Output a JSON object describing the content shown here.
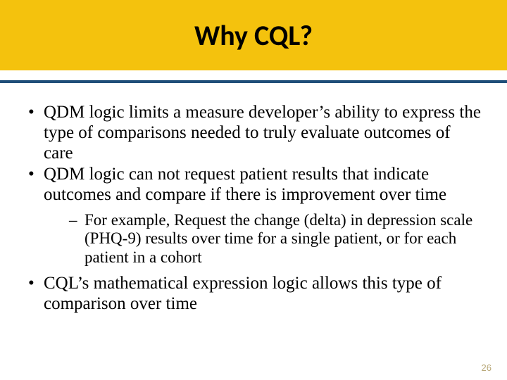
{
  "slide": {
    "title": "Why CQL?",
    "bullets": {
      "b1": "QDM logic limits a measure developer’s ability to express the type of comparisons needed to truly evaluate outcomes of care",
      "b2": "QDM logic can not request patient results that indicate outcomes and compare if there is improvement over time",
      "b2_sub1": "For example, Request the change (delta) in depression scale (PHQ-9) results over time for a single patient, or for each patient in a cohort",
      "b3": "CQL’s mathematical expression logic allows this type of comparison over time"
    },
    "page_number": "26"
  }
}
